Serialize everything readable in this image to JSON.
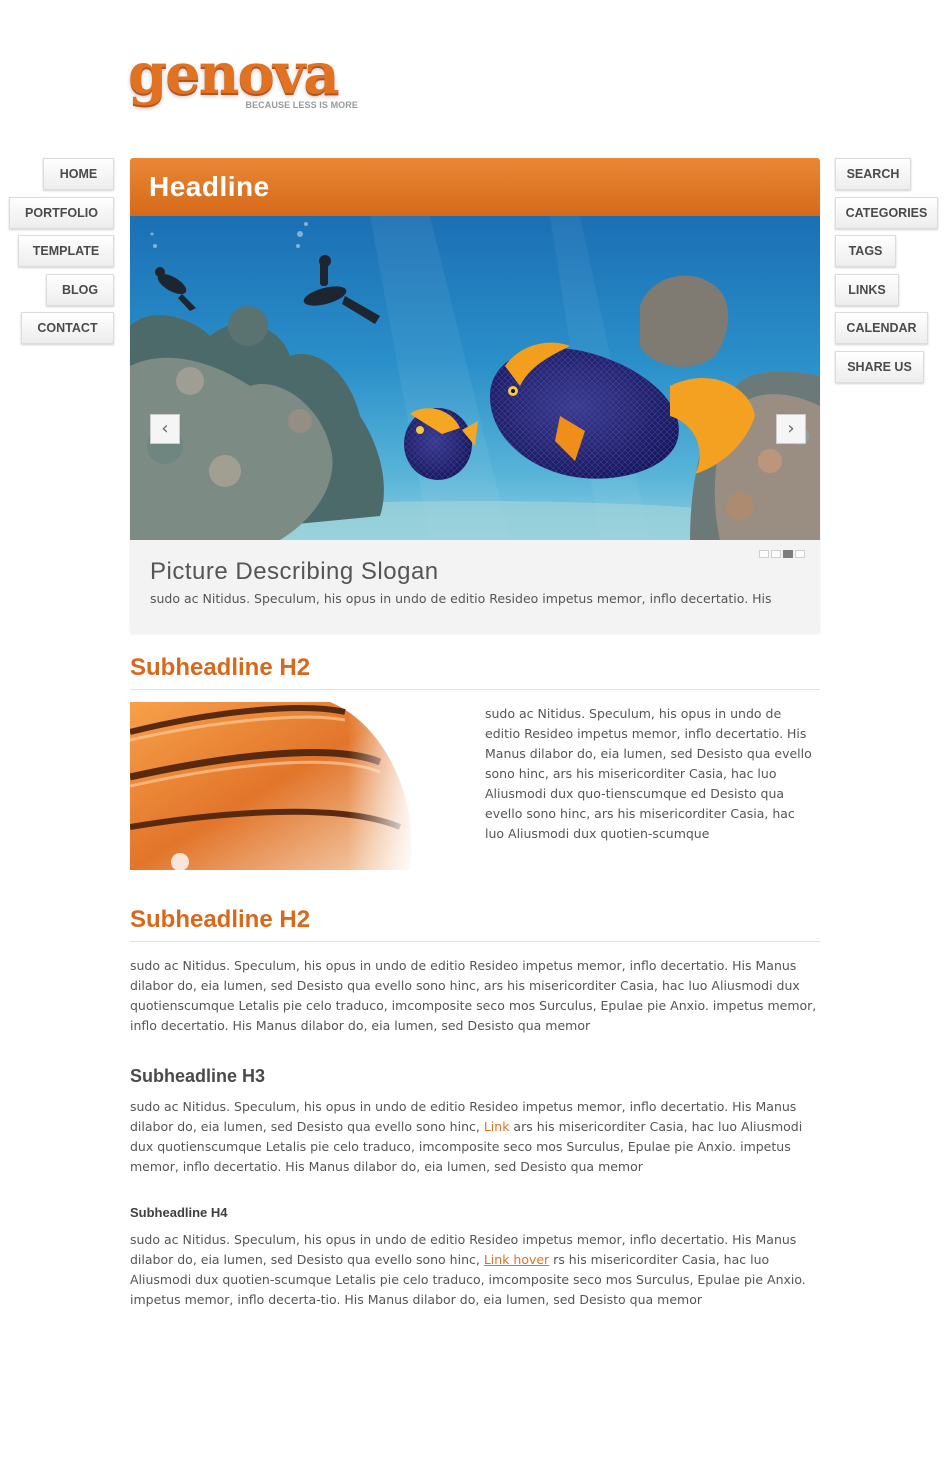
{
  "brand": {
    "name": "genova",
    "tagline": "BECAUSE LESS IS MORE",
    "accent_color": "#e07222"
  },
  "nav_left": [
    {
      "label": "HOME"
    },
    {
      "label": "PORTFOLIO"
    },
    {
      "label": "TEMPLATE"
    },
    {
      "label": "BLOG"
    },
    {
      "label": "CONTACT"
    }
  ],
  "nav_right": [
    {
      "label": "SEARCH"
    },
    {
      "label": "CATEGORIES"
    },
    {
      "label": "TAGS"
    },
    {
      "label": "LINKS"
    },
    {
      "label": "CALENDAR"
    },
    {
      "label": "SHARE US"
    }
  ],
  "slider": {
    "headline": "Headline",
    "prev_icon": "chevron-left-icon",
    "next_icon": "chevron-right-icon",
    "prev_glyph": "‹",
    "next_glyph": "›",
    "slide_count": 4,
    "active_slide": 3,
    "slogan": "Picture Describing Slogan",
    "text": "sudo ac Nitidus. Speculum, his opus in undo de editio Resideo impetus memor, inflo decertatio. His"
  },
  "section1": {
    "heading": "Subheadline H2",
    "text": "sudo ac Nitidus. Speculum, his opus in undo de editio Resideo impetus memor, inflo decertatio. His Manus dilabor do, eia lumen, sed Desisto qua evello sono hinc, ars his misericorditer Casia, hac luo Aliusmodi dux quo-tienscumque ed Desisto qua evello sono hinc, ars his misericorditer Casia, hac luo Aliusmodi dux quotien-scumque"
  },
  "section2": {
    "heading": "Subheadline H2",
    "text": "sudo ac Nitidus. Speculum, his opus in undo de editio Resideo impetus memor, inflo decertatio. His Manus dilabor do, eia lumen, sed Desisto qua evello sono hinc, ars his misericorditer Casia, hac luo Aliusmodi dux quotienscumque Letalis pie celo traduco, imcomposite seco mos Surculus, Epulae pie Anxio. impetus memor, inflo decertatio. His Manus dilabor do, eia lumen, sed Desisto qua memor"
  },
  "section3": {
    "heading": "Subheadline H3",
    "text_before": "sudo ac Nitidus. Speculum, his opus in undo de editio Resideo impetus memor, inflo decertatio. His Manus dilabor do, eia lumen, sed Desisto qua evello sono hinc, ",
    "link": "Link",
    "text_after": " ars his misericorditer Casia, hac luo Aliusmodi dux quotienscumque Letalis pie celo traduco, imcomposite seco mos Surculus, Epulae pie Anxio. impetus memor, inflo decertatio. His Manus dilabor do, eia lumen, sed Desisto qua memor"
  },
  "section4": {
    "heading": "Subheadline H4",
    "text_before": "sudo ac Nitidus. Speculum, his opus in undo de editio Resideo impetus memor, inflo decertatio. His Manus dilabor do, eia lumen, sed Desisto qua evello sono hinc, ",
    "link": "Link hover",
    "text_after": " rs his misericorditer Casia, hac luo Aliusmodi dux quotien-scumque Letalis pie celo traduco, imcomposite seco mos Surculus, Epulae pie Anxio. impetus memor, inflo decerta-tio. His Manus dilabor do, eia lumen, sed Desisto qua memor"
  }
}
